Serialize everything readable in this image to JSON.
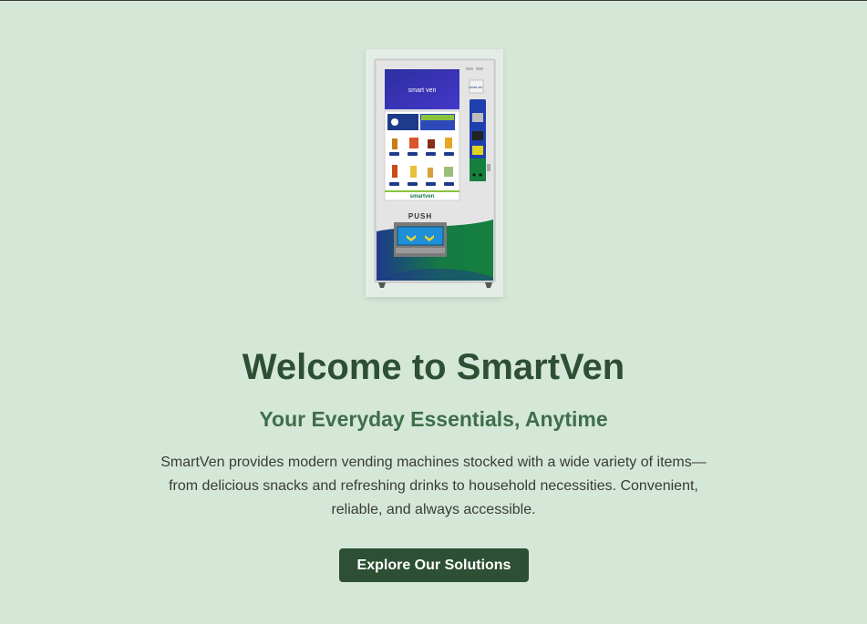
{
  "hero": {
    "title": "Welcome to SmartVen",
    "subtitle": "Your Everyday Essentials, Anytime",
    "description": "SmartVen provides modern vending machines stocked with a wide variety of items—from delicious snacks and refreshing drinks to household necessities. Convenient, reliable, and always accessible.",
    "cta_label": "Explore Our Solutions"
  },
  "machine": {
    "screen_logo": "smart ven",
    "side_logo": "smart ven",
    "brand_text": "smartven",
    "dispense_label": "PUSH"
  },
  "colors": {
    "background": "#d5e8d8",
    "heading": "#2d4f33",
    "subheading": "#3e6e4a",
    "button_bg": "#2d4f33",
    "button_text": "#ffffff",
    "machine_blue": "#1e3a8a",
    "machine_green": "#15803d"
  }
}
